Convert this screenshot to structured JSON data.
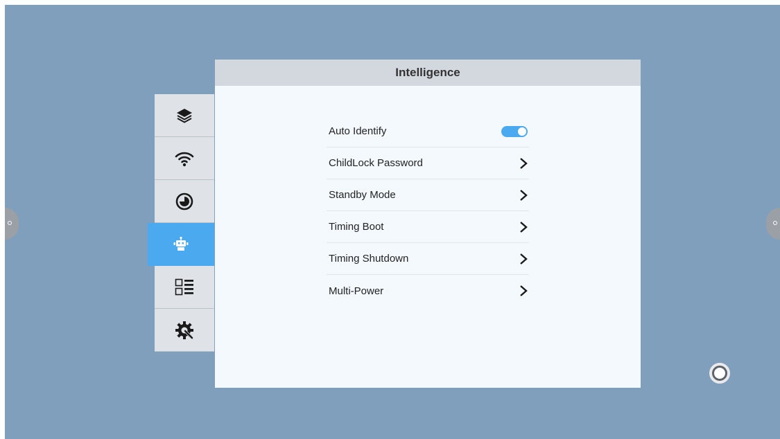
{
  "panel": {
    "title": "Intelligence"
  },
  "sidebar": {
    "items": [
      {
        "icon": "layers-icon",
        "active": false
      },
      {
        "icon": "wifi-icon",
        "active": false
      },
      {
        "icon": "clock-icon",
        "active": false
      },
      {
        "icon": "robot-icon",
        "active": true
      },
      {
        "icon": "apps-list-icon",
        "active": false
      },
      {
        "icon": "gear-wrench-icon",
        "active": false
      }
    ]
  },
  "menu": {
    "items": [
      {
        "label": "Auto Identify",
        "control": "toggle",
        "value": true
      },
      {
        "label": "ChildLock Password",
        "control": "chevron"
      },
      {
        "label": "Standby Mode",
        "control": "chevron"
      },
      {
        "label": "Timing Boot",
        "control": "chevron"
      },
      {
        "label": "Timing Shutdown",
        "control": "chevron"
      },
      {
        "label": "Multi-Power",
        "control": "chevron"
      }
    ]
  },
  "colors": {
    "accent": "#4aa9ef",
    "background": "#7f9fbd",
    "panel": "#f4f9fd",
    "header": "#d2d8de"
  }
}
